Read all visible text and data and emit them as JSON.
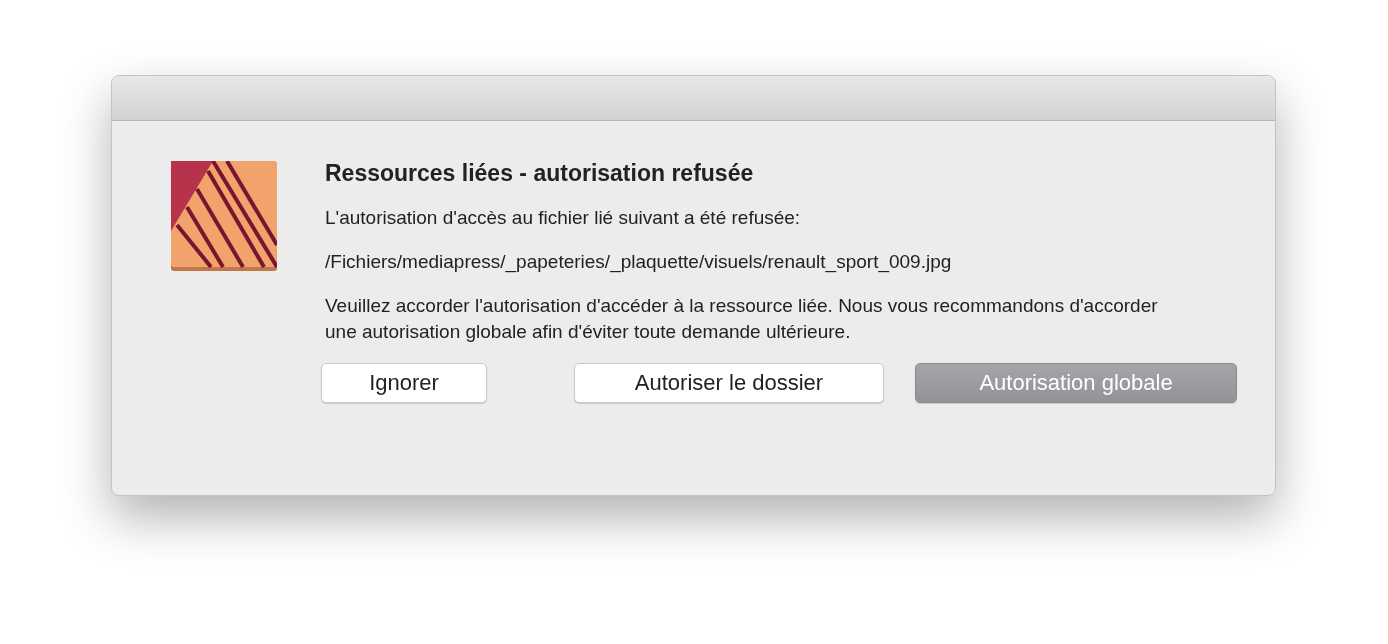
{
  "dialog": {
    "title": "Ressources liées - autorisation refusée",
    "message": "L'autorisation d'accès au fichier lié suivant a été refusée:",
    "path": "/Fichiers/mediapress/_papeteries/_plaquette/visuels/renault_sport_009.jpg",
    "advice": "Veuillez accorder l'autorisation d'accéder à la ressource liée. Nous vous recommandons d'accorder une autorisation globale afin d'éviter toute demande ultérieure.",
    "buttons": [
      {
        "label": "Ignorer",
        "default": false
      },
      {
        "label": "Autoriser le dossier",
        "default": false
      },
      {
        "label": "Autorisation globale",
        "default": true
      }
    ]
  }
}
